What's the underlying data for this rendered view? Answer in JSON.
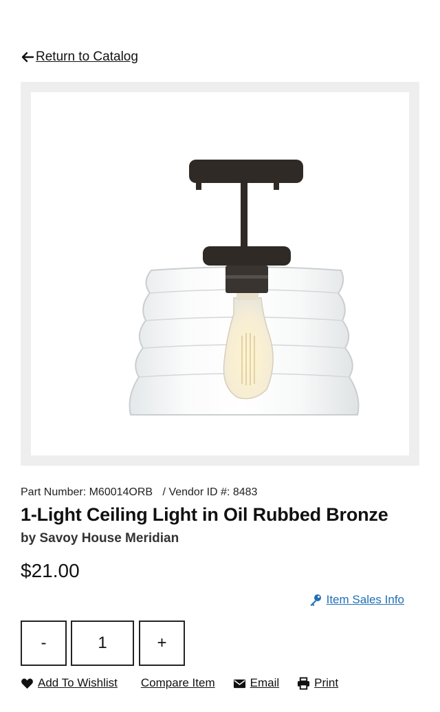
{
  "navigation": {
    "return_label": "Return to Catalog"
  },
  "product": {
    "part_number_label": "Part Number:",
    "part_number": "M60014ORB",
    "vendor_label": "/ Vendor ID #:",
    "vendor_id": "8483",
    "title": "1-Light Ceiling Light in Oil Rubbed Bronze",
    "brand": "by Savoy House Meridian",
    "price": "$21.00"
  },
  "sales_info": {
    "label": "Item Sales Info",
    "icon": "key-icon"
  },
  "quantity": {
    "minus_label": "-",
    "value": "1",
    "plus_label": "+"
  },
  "actions": {
    "wishlist": {
      "label": "Add To Wishlist",
      "icon": "heart-icon"
    },
    "compare": {
      "label": "Compare Item"
    },
    "email": {
      "label": "Email",
      "icon": "envelope-icon"
    },
    "print": {
      "label": "Print",
      "icon": "printer-icon"
    }
  },
  "colors": {
    "link_blue": "#1f6fb5",
    "frame_gray": "#eeeeee",
    "bronze": "#2f2a26"
  }
}
